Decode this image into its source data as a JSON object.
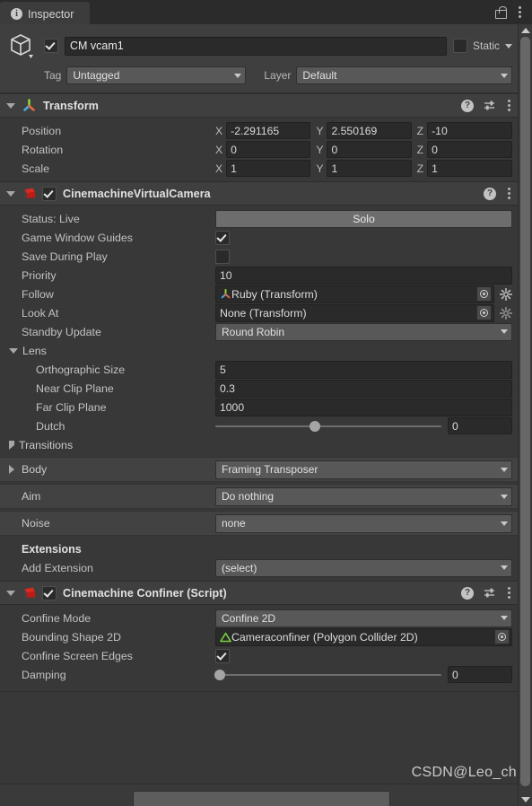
{
  "window": {
    "tab_label": "Inspector",
    "tab_icon": "info-icon",
    "lock_icon": "lock-open-icon",
    "menu_icon": "kebab-menu-icon"
  },
  "object_header": {
    "icon": "cube-icon",
    "enabled_checkbox": true,
    "name": "CM vcam1",
    "static_label": "Static",
    "static_checked": false,
    "tag_label": "Tag",
    "tag_value": "Untagged",
    "layer_label": "Layer",
    "layer_value": "Default"
  },
  "transform": {
    "title": "Transform",
    "icon": "transform-axis-icon",
    "help_icon": "help-icon",
    "preset_icon": "preset-icon",
    "menu_icon": "kebab-menu-icon",
    "rows": [
      {
        "label": "Position",
        "x": "-2.291165",
        "y": "2.550169",
        "z": "-10"
      },
      {
        "label": "Rotation",
        "x": "0",
        "y": "0",
        "z": "0"
      },
      {
        "label": "Scale",
        "x": "1",
        "y": "1",
        "z": "1"
      }
    ],
    "axis_labels": [
      "X",
      "Y",
      "Z"
    ]
  },
  "virtual_camera": {
    "title": "CinemachineVirtualCamera",
    "icon": "cinemachine-icon",
    "enabled_checkbox": true,
    "help_icon": "help-icon",
    "menu_icon": "kebab-menu-icon",
    "status_label": "Status: Live",
    "solo_button": "Solo",
    "game_window_guides_label": "Game Window Guides",
    "game_window_guides_checked": true,
    "save_during_play_label": "Save During Play",
    "save_during_play_checked": false,
    "priority_label": "Priority",
    "priority_value": "10",
    "follow_label": "Follow",
    "follow_value": "Ruby (Transform)",
    "follow_has_icon": true,
    "look_at_label": "Look At",
    "look_at_value": "None (Transform)",
    "standby_update_label": "Standby Update",
    "standby_update_value": "Round Robin",
    "lens": {
      "title": "Lens",
      "expanded": true,
      "orthographic_size_label": "Orthographic Size",
      "orthographic_size_value": "5",
      "near_clip_label": "Near Clip Plane",
      "near_clip_value": "0.3",
      "far_clip_label": "Far Clip Plane",
      "far_clip_value": "1000",
      "dutch_label": "Dutch",
      "dutch_value": "0",
      "dutch_slider_pct": 44
    },
    "transitions_label": "Transitions",
    "transitions_expanded": false,
    "pipeline": [
      {
        "label": "Body",
        "value": "Framing Transposer",
        "foldout": true
      },
      {
        "label": "Aim",
        "value": "Do nothing",
        "foldout": false
      },
      {
        "label": "Noise",
        "value": "none",
        "foldout": false
      }
    ],
    "extensions_title": "Extensions",
    "add_extension_label": "Add Extension",
    "add_extension_value": "(select)"
  },
  "confiner": {
    "title": "Cinemachine Confiner (Script)",
    "icon": "cinemachine-icon",
    "enabled_checkbox": true,
    "help_icon": "help-icon",
    "preset_icon": "preset-icon",
    "menu_icon": "kebab-menu-icon",
    "confine_mode_label": "Confine Mode",
    "confine_mode_value": "Confine 2D",
    "bounding_shape_label": "Bounding Shape 2D",
    "bounding_shape_value": "Cameraconfiner (Polygon Collider 2D)",
    "confine_screen_edges_label": "Confine Screen Edges",
    "confine_screen_edges_checked": true,
    "damping_label": "Damping",
    "damping_value": "0",
    "damping_slider_pct": 2
  },
  "watermark": "CSDN@Leo_ch",
  "colors": {
    "panel_bg": "#383838",
    "header_bg": "#3f3f3f",
    "field_bg": "#2a2a2a",
    "dropdown_bg": "#585858",
    "accent_green": "#76d13c",
    "accent_red": "#d02020"
  }
}
